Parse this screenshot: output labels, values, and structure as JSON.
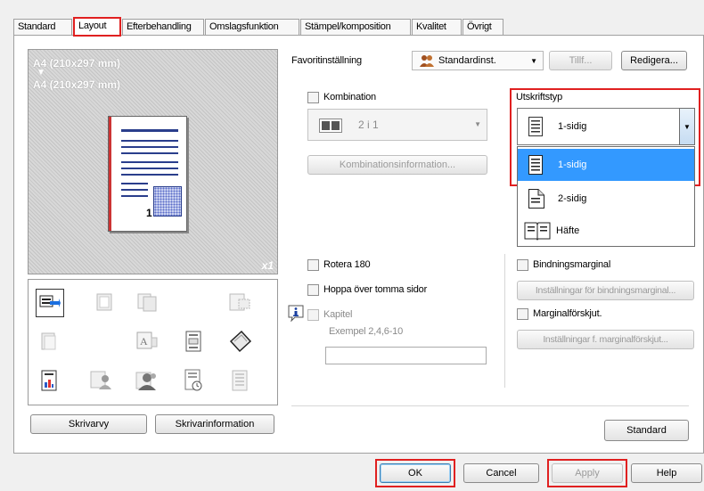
{
  "tabs": [
    {
      "label": "Standard"
    },
    {
      "label": "Layout"
    },
    {
      "label": "Efterbehandling"
    },
    {
      "label": "Omslagsfunktion"
    },
    {
      "label": "Stämpel/komposition"
    },
    {
      "label": "Kvalitet"
    },
    {
      "label": "Övrigt"
    }
  ],
  "preview": {
    "paper_from": "A4 (210x297 mm)",
    "arrow": "▼",
    "paper_to": "A4 (210x297 mm)",
    "copies": "x1",
    "page_number": "1"
  },
  "preview_buttons": {
    "printer_view": "Skrivarvy",
    "printer_info": "Skrivarinformation"
  },
  "favorites": {
    "label": "Favoritinställning",
    "selected": "Standardinst.",
    "add": "Tillf...",
    "edit": "Redigera..."
  },
  "combination": {
    "label": "Kombination",
    "value": "2 i 1",
    "info_button": "Kombinationsinformation..."
  },
  "print_type": {
    "label": "Utskriftstyp",
    "selected": "1-sidig",
    "options": [
      {
        "label": "1-sidig"
      },
      {
        "label": "2-sidig"
      },
      {
        "label": "Häfte"
      }
    ]
  },
  "rotate": {
    "label": "Rotera 180"
  },
  "skip_blank": {
    "label": "Hoppa över tomma sidor"
  },
  "chapter": {
    "label": "Kapitel",
    "example": "Exempel 2,4,6-10"
  },
  "binding_margin": {
    "label": "Bindningsmarginal",
    "settings_button": "Inställningar för bindningsmarginal..."
  },
  "margin_shift": {
    "label": "Marginalförskjut.",
    "settings_button": "Inställningar f. marginalförskjut..."
  },
  "standard_button": "Standard",
  "dialog_buttons": {
    "ok": "OK",
    "cancel": "Cancel",
    "apply": "Apply",
    "help": "Help"
  },
  "colors": {
    "highlight": "#3399ff",
    "annotation_red": "#e02020"
  }
}
